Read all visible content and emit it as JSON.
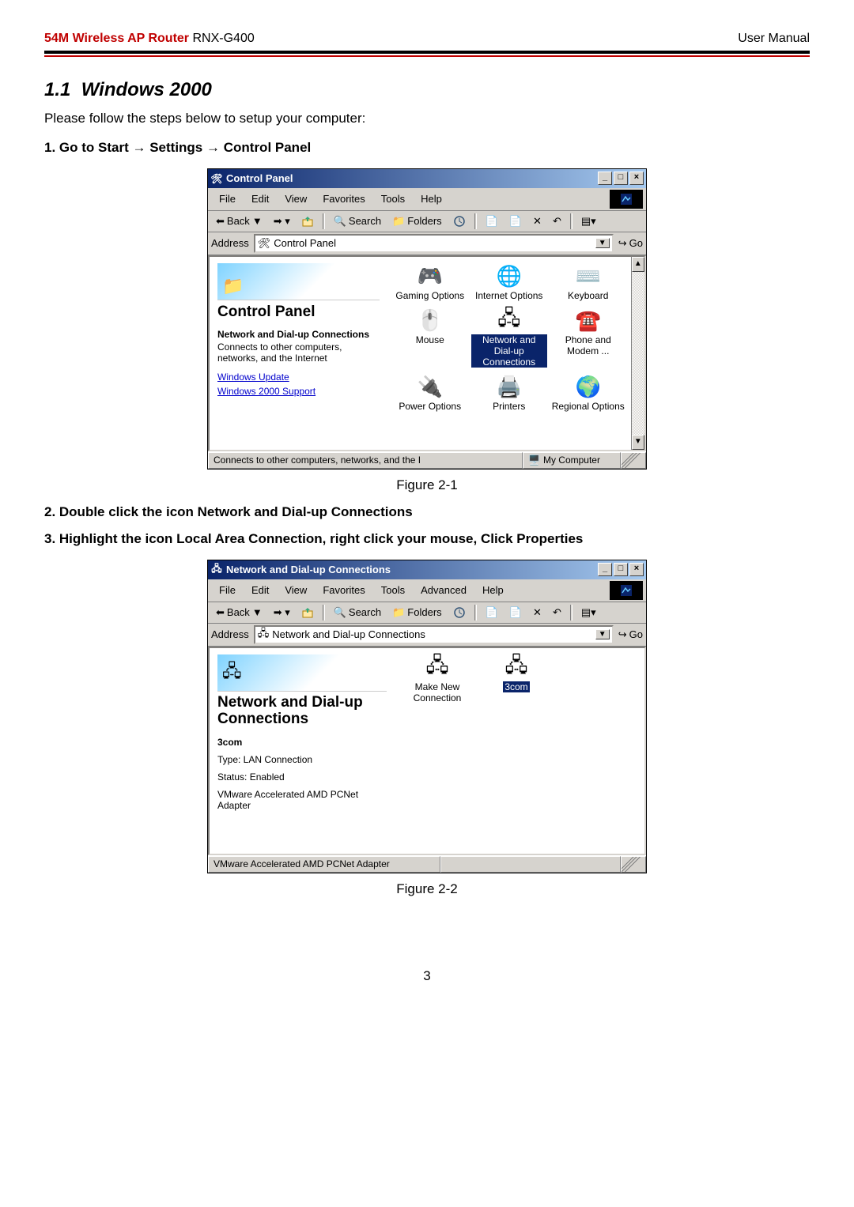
{
  "header": {
    "product_red": "54M Wireless AP Router",
    "model": "RNX-G400",
    "right": "User Manual"
  },
  "section": {
    "number": "1.1",
    "title": "Windows 2000",
    "intro": "Please follow the steps below to setup your computer:",
    "step1_prefix": "1. Go to Start ",
    "step1_mid": " Settings ",
    "step1_end": " Control Panel",
    "arrow": "→",
    "step2": "2. Double click the icon Network and Dial-up Connections",
    "step3": "3. Highlight the icon Local Area Connection, right click your mouse, Click Properties",
    "fig1": "Figure 2-1",
    "fig2": "Figure 2-2"
  },
  "win1": {
    "title": "Control Panel",
    "menus": [
      "File",
      "Edit",
      "View",
      "Favorites",
      "Tools",
      "Help"
    ],
    "toolbar": {
      "back": "Back",
      "search": "Search",
      "folders": "Folders"
    },
    "address_label": "Address",
    "address_value": "Control Panel",
    "go": "Go",
    "sidebar": {
      "heading": "Control Panel",
      "item_title": "Network and Dial-up Connections",
      "item_desc": "Connects to other computers, networks, and the Internet",
      "link1": "Windows Update",
      "link2": "Windows 2000 Support"
    },
    "icons": {
      "r1c1": "Gaming Options",
      "r1c2": "Internet Options",
      "r1c3": "Keyboard",
      "r2c1": "Mouse",
      "r2c2": "Network and Dial-up Connections",
      "r2c3": "Phone and Modem ...",
      "r3c1": "Power Options",
      "r3c2": "Printers",
      "r3c3": "Regional Options"
    },
    "status_left": "Connects to other computers, networks, and the I",
    "status_right": "My Computer"
  },
  "win2": {
    "title": "Network and Dial-up Connections",
    "menus": [
      "File",
      "Edit",
      "View",
      "Favorites",
      "Tools",
      "Advanced",
      "Help"
    ],
    "toolbar": {
      "back": "Back",
      "search": "Search",
      "folders": "Folders"
    },
    "address_label": "Address",
    "address_value": "Network and Dial-up Connections",
    "go": "Go",
    "sidebar": {
      "heading": "Network and Dial-up Connections",
      "sel_title": "3com",
      "type": "Type: LAN Connection",
      "status": "Status: Enabled",
      "adapter": "VMware Accelerated AMD PCNet Adapter"
    },
    "icons": {
      "c1": "Make New Connection",
      "c2": "3com"
    },
    "status_left": "VMware Accelerated AMD PCNet Adapter"
  },
  "page_number": "3"
}
